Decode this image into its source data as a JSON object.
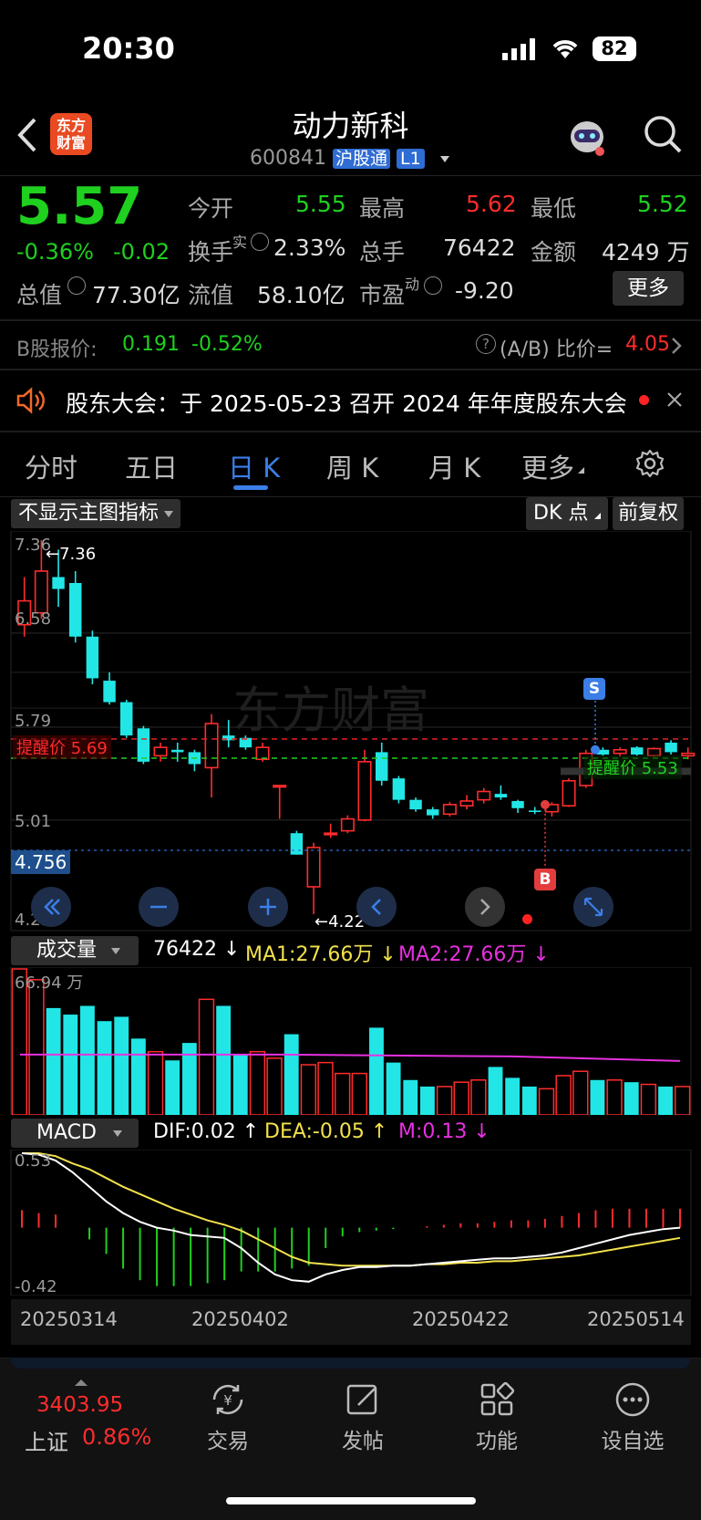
{
  "status_bar": {
    "time": "20:30",
    "battery": "82"
  },
  "header": {
    "stock_name": "动力新科",
    "stock_code": "600841",
    "badge_hgt": "沪股通",
    "badge_l1": "L1",
    "logo_line1": "东方",
    "logo_line2": "财富"
  },
  "quote": {
    "price": "5.57",
    "change_pct": "-0.36%",
    "change_amt": "-0.02",
    "open_label": "今开",
    "open": "5.55",
    "high_label": "最高",
    "high": "5.62",
    "low_label": "最低",
    "low": "5.52",
    "turnover_label": "换手",
    "turnover_sup": "实",
    "turnover": "2.33%",
    "volume_label": "总手",
    "volume": "76422",
    "amount_label": "金额",
    "amount": "4249 万",
    "mktcap_label": "总值",
    "mktcap": "77.30亿",
    "float_label": "流值",
    "float_cap": "58.10亿",
    "pe_label": "市盈",
    "pe_sup": "动",
    "pe": "-9.20",
    "more_label": "更多"
  },
  "bshare": {
    "label": "B股报价:",
    "price": "0.191",
    "change": "-0.52%",
    "ratio_label": "(A/B) 比价=",
    "ratio": "4.05"
  },
  "notice": {
    "text": "股东大会：于 2025-05-23 召开 2024 年年度股东大会"
  },
  "tabs": [
    {
      "label": "分时"
    },
    {
      "label": "五日"
    },
    {
      "label": "日 K"
    },
    {
      "label": "周 K"
    },
    {
      "label": "月 K"
    },
    {
      "label": "更多"
    }
  ],
  "chart_toolbar": {
    "indicator_select": "不显示主图指标",
    "dk_label": "DK 点",
    "adjust_label": "前复权"
  },
  "main_chart": {
    "price_labels": {
      "top": "7.36",
      "l2": "6.58",
      "l3": "5.79",
      "l4": "5.01",
      "bottom": "4.22"
    },
    "max_marker": "7.36",
    "min_marker": "4.22",
    "current_tag": "4.756",
    "alert_red_label": "提醒价 5.69",
    "alert_green_label": "提醒价 5.53",
    "sell_marker": "S",
    "buy_marker": "B",
    "watermark": "东方财富"
  },
  "volume_panel": {
    "select_label": "成交量",
    "value": "76422",
    "ma1": "MA1:27.66万",
    "ma2": "MA2:27.66万",
    "max_label": "66.94 万"
  },
  "macd_panel": {
    "select_label": "MACD",
    "dif": "DIF:0.02",
    "dea": "DEA:-0.05",
    "m": "M:0.13",
    "top_label": "0.53",
    "bottom_label": "-0.42"
  },
  "dates": [
    "20250314",
    "20250402",
    "20250422",
    "20250514"
  ],
  "bottom_nav": {
    "index_value": "3403.95",
    "index_name": "上证",
    "index_change": "0.86%",
    "items": [
      {
        "label": "交易",
        "icon": "exchange-yen-icon"
      },
      {
        "label": "发帖",
        "icon": "edit-post-icon"
      },
      {
        "label": "功能",
        "icon": "grid-functions-icon"
      },
      {
        "label": "设自选",
        "icon": "more-dots-icon"
      }
    ]
  },
  "colors": {
    "up": "#ff2c2c",
    "down": "#22e6e6",
    "green_text": "#1fd01f",
    "accent": "#3b7ee8"
  },
  "chart_data": [
    {
      "type": "candlestick",
      "title": "",
      "ylim": [
        4.22,
        7.36
      ],
      "x": [
        "20250314",
        "20250402",
        "20250422",
        "20250514"
      ],
      "candles": [
        {
          "o": 6.65,
          "c": 6.85,
          "h": 7.05,
          "l": 6.55
        },
        {
          "o": 6.75,
          "c": 7.1,
          "h": 7.36,
          "l": 6.7
        },
        {
          "o": 7.05,
          "c": 6.95,
          "h": 7.28,
          "l": 6.8
        },
        {
          "o": 7.0,
          "c": 6.55,
          "h": 7.1,
          "l": 6.5
        },
        {
          "o": 6.55,
          "c": 6.2,
          "h": 6.6,
          "l": 6.15
        },
        {
          "o": 6.18,
          "c": 6.0,
          "h": 6.25,
          "l": 5.98
        },
        {
          "o": 6.0,
          "c": 5.72,
          "h": 6.02,
          "l": 5.7
        },
        {
          "o": 5.78,
          "c": 5.5,
          "h": 5.8,
          "l": 5.48
        },
        {
          "o": 5.55,
          "c": 5.62,
          "h": 5.66,
          "l": 5.5
        },
        {
          "o": 5.6,
          "c": 5.58,
          "h": 5.66,
          "l": 5.5
        },
        {
          "o": 5.58,
          "c": 5.48,
          "h": 5.6,
          "l": 5.42
        },
        {
          "o": 5.45,
          "c": 5.82,
          "h": 5.9,
          "l": 5.2
        },
        {
          "o": 5.72,
          "c": 5.68,
          "h": 5.85,
          "l": 5.62
        },
        {
          "o": 5.7,
          "c": 5.62,
          "h": 5.72,
          "l": 5.6
        },
        {
          "o": 5.52,
          "c": 5.62,
          "h": 5.66,
          "l": 5.5
        },
        {
          "o": 5.3,
          "c": 5.3,
          "h": 5.3,
          "l": 5.02
        },
        {
          "o": 4.9,
          "c": 4.72,
          "h": 4.92,
          "l": 4.72
        },
        {
          "o": 4.45,
          "c": 4.78,
          "h": 4.82,
          "l": 4.22
        },
        {
          "o": 4.9,
          "c": 4.9,
          "h": 4.98,
          "l": 4.86
        },
        {
          "o": 4.92,
          "c": 5.02,
          "h": 5.05,
          "l": 4.9
        },
        {
          "o": 5.01,
          "c": 5.5,
          "h": 5.6,
          "l": 5.0
        },
        {
          "o": 5.58,
          "c": 5.34,
          "h": 5.66,
          "l": 5.3
        },
        {
          "o": 5.36,
          "c": 5.18,
          "h": 5.38,
          "l": 5.15
        },
        {
          "o": 5.18,
          "c": 5.1,
          "h": 5.2,
          "l": 5.08
        },
        {
          "o": 5.1,
          "c": 5.05,
          "h": 5.12,
          "l": 5.02
        },
        {
          "o": 5.06,
          "c": 5.14,
          "h": 5.16,
          "l": 5.04
        },
        {
          "o": 5.13,
          "c": 5.17,
          "h": 5.22,
          "l": 5.1
        },
        {
          "o": 5.18,
          "c": 5.25,
          "h": 5.28,
          "l": 5.15
        },
        {
          "o": 5.23,
          "c": 5.2,
          "h": 5.3,
          "l": 5.18
        },
        {
          "o": 5.17,
          "c": 5.11,
          "h": 5.18,
          "l": 5.07
        },
        {
          "o": 5.09,
          "c": 5.08,
          "h": 5.12,
          "l": 5.06
        },
        {
          "o": 5.08,
          "c": 5.14,
          "h": 5.16,
          "l": 5.04
        },
        {
          "o": 5.13,
          "c": 5.34,
          "h": 5.36,
          "l": 5.12
        },
        {
          "o": 5.3,
          "c": 5.57,
          "h": 5.6,
          "l": 5.28
        },
        {
          "o": 5.6,
          "c": 5.56,
          "h": 5.62,
          "l": 5.55
        },
        {
          "o": 5.57,
          "c": 5.6,
          "h": 5.62,
          "l": 5.54
        },
        {
          "o": 5.62,
          "c": 5.56,
          "h": 5.63,
          "l": 5.55
        },
        {
          "o": 5.55,
          "c": 5.61,
          "h": 5.62,
          "l": 5.54
        },
        {
          "o": 5.66,
          "c": 5.58,
          "h": 5.68,
          "l": 5.56
        },
        {
          "o": 5.55,
          "c": 5.57,
          "h": 5.62,
          "l": 5.52
        }
      ]
    },
    {
      "type": "bar",
      "title": "成交量",
      "unit": "万",
      "ylim": [
        0,
        66.94
      ],
      "values": [
        66.94,
        62,
        49,
        46,
        50,
        43,
        45,
        35,
        29,
        25,
        33,
        53,
        50,
        28,
        29,
        26,
        37,
        23,
        24,
        19,
        19,
        40,
        24,
        16,
        13,
        13,
        15,
        16,
        22,
        17,
        13,
        12,
        18,
        20,
        16,
        16,
        15,
        14,
        13,
        13
      ],
      "ma_line": 27.66
    },
    {
      "type": "line",
      "title": "MACD",
      "ylim": [
        -0.42,
        0.53
      ],
      "series": [
        {
          "name": "DIF",
          "values": [
            0.53,
            0.52,
            0.48,
            0.4,
            0.3,
            0.2,
            0.12,
            0.06,
            0.02,
            0.0,
            -0.03,
            -0.04,
            -0.05,
            -0.12,
            -0.22,
            -0.3,
            -0.34,
            -0.35,
            -0.3,
            -0.27,
            -0.25,
            -0.25,
            -0.24,
            -0.24,
            -0.23,
            -0.22,
            -0.21,
            -0.2,
            -0.19,
            -0.19,
            -0.18,
            -0.17,
            -0.15,
            -0.12,
            -0.09,
            -0.06,
            -0.03,
            -0.01,
            0.01,
            0.02
          ]
        },
        {
          "name": "DEA",
          "values": [
            0.53,
            0.53,
            0.51,
            0.46,
            0.42,
            0.36,
            0.3,
            0.25,
            0.2,
            0.15,
            0.11,
            0.07,
            0.04,
            0.0,
            -0.06,
            -0.12,
            -0.18,
            -0.22,
            -0.23,
            -0.24,
            -0.24,
            -0.24,
            -0.24,
            -0.24,
            -0.23,
            -0.23,
            -0.22,
            -0.22,
            -0.21,
            -0.21,
            -0.2,
            -0.19,
            -0.18,
            -0.17,
            -0.15,
            -0.13,
            -0.11,
            -0.09,
            -0.07,
            -0.05
          ]
        },
        {
          "name": "M",
          "values": [
            0.12,
            0.1,
            0.09,
            0.0,
            -0.08,
            -0.18,
            -0.28,
            -0.36,
            -0.4,
            -0.4,
            -0.4,
            -0.38,
            -0.36,
            -0.3,
            -0.3,
            -0.3,
            -0.28,
            -0.26,
            -0.14,
            -0.06,
            -0.03,
            -0.02,
            -0.01,
            0.0,
            0.01,
            0.02,
            0.03,
            0.03,
            0.04,
            0.05,
            0.05,
            0.06,
            0.08,
            0.1,
            0.12,
            0.13,
            0.13,
            0.13,
            0.13,
            0.13
          ]
        }
      ]
    }
  ]
}
